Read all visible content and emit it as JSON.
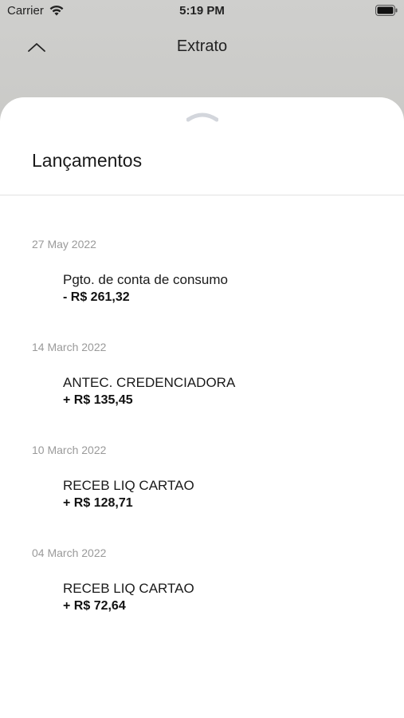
{
  "status_bar": {
    "carrier": "Carrier",
    "time": "5:19 PM",
    "icons": [
      "wifi-icon",
      "battery-icon"
    ]
  },
  "nav": {
    "title": "Extrato",
    "collapse_icon": "chevron-up-icon"
  },
  "sheet": {
    "grabber_icon": "chevron-up-icon",
    "title": "Lançamentos"
  },
  "transactions": [
    {
      "date": "27 May 2022",
      "description": "Pgto. de conta de consumo",
      "amount": "- R$ 261,32"
    },
    {
      "date": "14 March 2022",
      "description": "ANTEC. CREDENCIADORA",
      "amount": "+ R$ 135,45"
    },
    {
      "date": "10 March 2022",
      "description": "RECEB LIQ CARTAO",
      "amount": "+ R$ 128,71"
    },
    {
      "date": "04 March 2022",
      "description": "RECEB LIQ CARTAO",
      "amount": "+ R$ 72,64"
    }
  ],
  "colors": {
    "header_gradient_top": "#cfcfcd",
    "header_gradient_bottom": "#b3b3ae",
    "sheet_background": "#ffffff",
    "date_text": "#9a9a9a"
  }
}
